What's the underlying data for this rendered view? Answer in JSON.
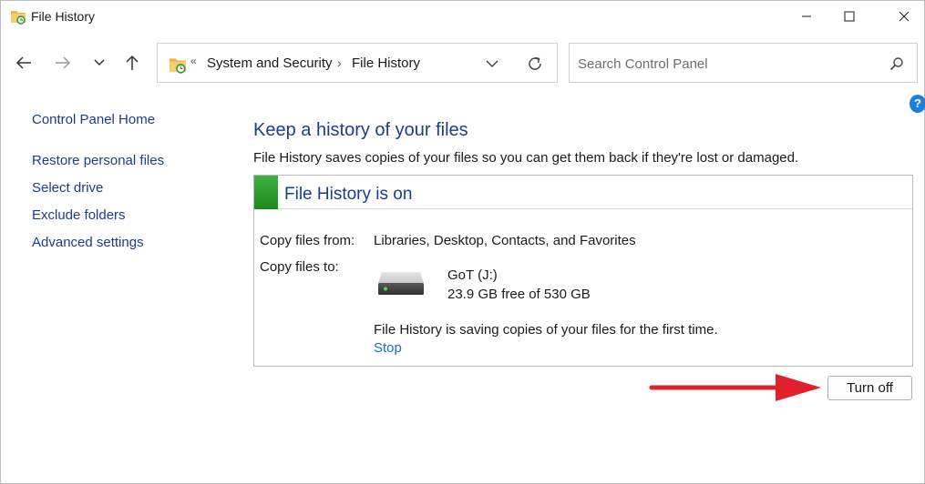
{
  "window": {
    "title": "File History"
  },
  "address": {
    "overflow": "«",
    "crumbs": [
      "System and Security",
      "File History"
    ],
    "separator": "›"
  },
  "search": {
    "placeholder": "Search Control Panel"
  },
  "help": {
    "glyph": "?"
  },
  "sidebar": {
    "items": [
      {
        "label": "Control Panel Home"
      },
      {
        "label": "Restore personal files"
      },
      {
        "label": "Select drive"
      },
      {
        "label": "Exclude folders"
      },
      {
        "label": "Advanced settings"
      }
    ]
  },
  "main": {
    "heading": "Keep a history of your files",
    "description": "File History saves copies of your files so you can get them back if they're lost or damaged.",
    "panel": {
      "title": "File History is on",
      "copy_from_label": "Copy files from:",
      "copy_from_value": "Libraries, Desktop, Contacts, and Favorites",
      "copy_to_label": "Copy files to:",
      "drive_name": "GoT (J:)",
      "drive_free": "23.9 GB free of 530 GB",
      "status": "File History is saving copies of your files for the first time.",
      "stop_label": "Stop"
    },
    "turn_off_label": "Turn off"
  },
  "colors": {
    "link": "#1a3e8c",
    "status_green": "#2e9e2e",
    "arrow_red": "#e0202a"
  }
}
